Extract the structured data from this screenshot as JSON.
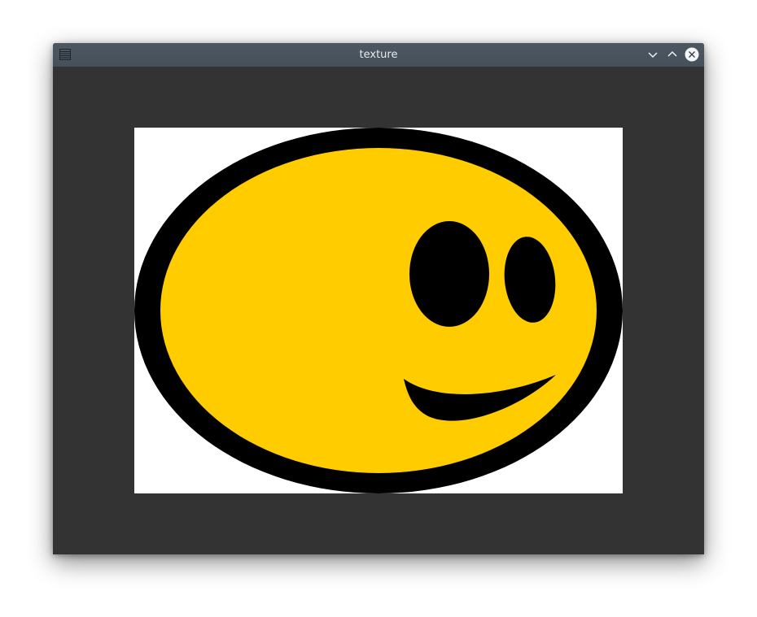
{
  "window": {
    "title": "texture"
  },
  "titlebar": {
    "menu_icon": "window-menu-icon",
    "minimize_icon": "chevron-down-icon",
    "maximize_icon": "chevron-up-icon",
    "close_icon": "close-icon"
  },
  "colors": {
    "background": "#333333",
    "titlebar": "#4a545e",
    "face_fill": "#ffcc00",
    "face_outline": "#000000",
    "texture_bg": "#ffffff"
  }
}
